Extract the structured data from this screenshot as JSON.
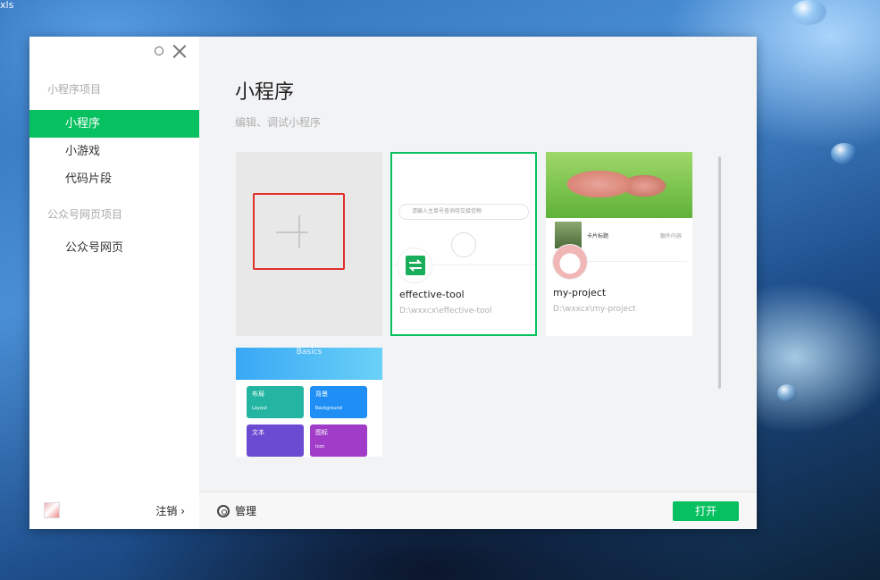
{
  "desktop": {
    "corner_label": "xls"
  },
  "sidebar": {
    "section_miniprogram": "小程序项目",
    "items": [
      {
        "label": "小程序",
        "active": true
      },
      {
        "label": "小游戏",
        "active": false
      },
      {
        "label": "代码片段",
        "active": false
      }
    ],
    "section_web": "公众号网页项目",
    "web_items": [
      {
        "label": "公众号网页"
      }
    ],
    "logout_label": "注销 ›"
  },
  "main": {
    "title": "小程序",
    "subtitle": "编辑、调试小程序",
    "projects": [
      {
        "name": "effective-tool",
        "path": "D:\\wxxcx\\effective-tool",
        "thumb_search": "请输入主单号查询待交接信物"
      },
      {
        "name": "my-project",
        "path": "D:\\wxxcx\\my-project",
        "thumb_list_title": "卡片标题",
        "thumb_list_more": "额外内容"
      },
      {
        "name": "",
        "path": "",
        "thumb_header": "Basics",
        "tiles": [
          {
            "label": "布局",
            "sub": "Layout",
            "color": "#23b5a2"
          },
          {
            "label": "背景",
            "sub": "Background",
            "color": "#1f8ff5"
          },
          {
            "label": "文本",
            "sub": "",
            "color": "#6a4bd1"
          },
          {
            "label": "图标",
            "sub": "Icon",
            "color": "#a03cc8"
          }
        ]
      }
    ]
  },
  "footer": {
    "manage_label": "管理",
    "open_label": "打开"
  },
  "colors": {
    "accent": "#07c160",
    "highlight": "#e0302a"
  }
}
